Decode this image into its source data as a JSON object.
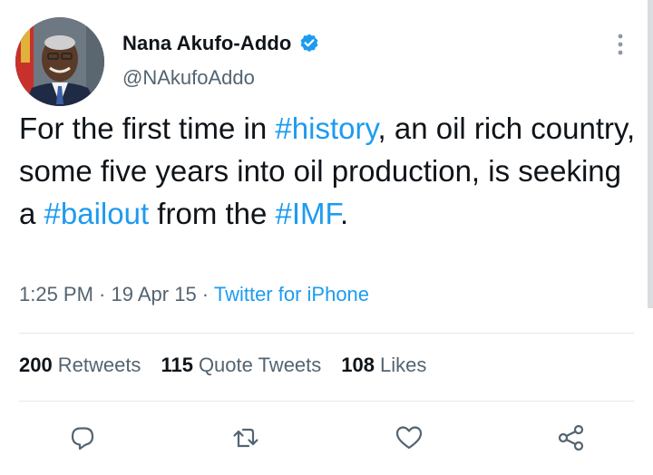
{
  "user": {
    "display_name": "Nana Akufo-Addo",
    "handle": "@NAkufoAddo",
    "verified": true
  },
  "tweet": {
    "segments": [
      {
        "text": "For the first time in ",
        "hashtag": false
      },
      {
        "text": "#history",
        "hashtag": true
      },
      {
        "text": ", an oil rich country, some five years into oil production, is seeking a ",
        "hashtag": false
      },
      {
        "text": "#bailout",
        "hashtag": true
      },
      {
        "text": " from the ",
        "hashtag": false
      },
      {
        "text": "#IMF",
        "hashtag": true
      },
      {
        "text": ".",
        "hashtag": false
      }
    ]
  },
  "meta": {
    "time": "1:25 PM",
    "separator": " · ",
    "date": "19 Apr 15",
    "source": "Twitter for iPhone"
  },
  "stats": {
    "retweets_count": "200",
    "retweets_label": "Retweets",
    "quotes_count": "115",
    "quotes_label": "Quote Tweets",
    "likes_count": "108",
    "likes_label": "Likes"
  },
  "actions": [
    {
      "name": "reply-icon"
    },
    {
      "name": "retweet-icon"
    },
    {
      "name": "like-icon"
    },
    {
      "name": "share-icon"
    }
  ],
  "colors": {
    "accent": "#1d9bf0",
    "text_primary": "#0f1419",
    "text_secondary": "#536471",
    "divider": "#e3e7ea"
  }
}
